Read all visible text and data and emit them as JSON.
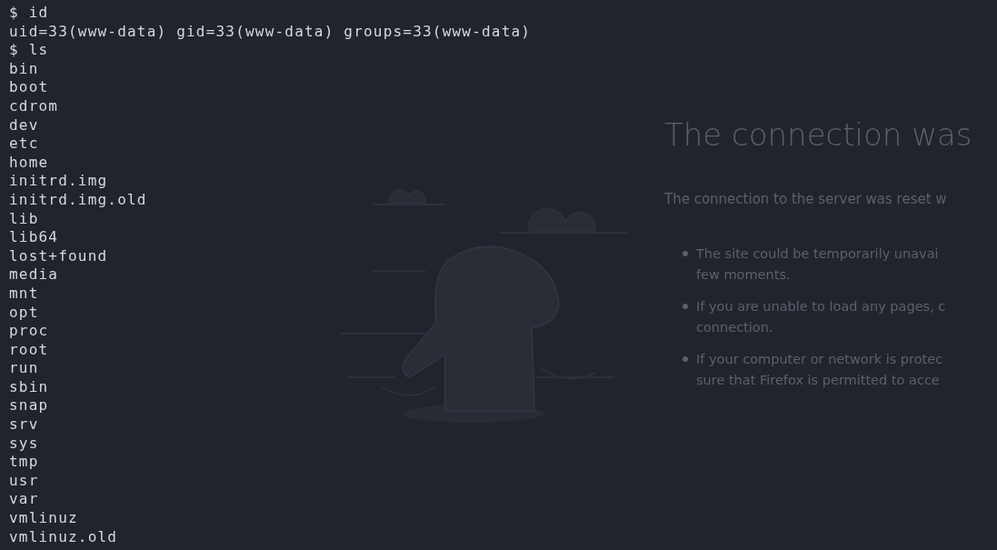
{
  "terminal": {
    "lines": [
      {
        "kind": "command",
        "prompt": "$",
        "text": "id"
      },
      {
        "kind": "output",
        "text": "uid=33(www-data) gid=33(www-data) groups=33(www-data)"
      },
      {
        "kind": "command",
        "prompt": "$",
        "text": "ls"
      },
      {
        "kind": "output",
        "text": "bin"
      },
      {
        "kind": "output",
        "text": "boot"
      },
      {
        "kind": "output",
        "text": "cdrom"
      },
      {
        "kind": "output",
        "text": "dev"
      },
      {
        "kind": "output",
        "text": "etc"
      },
      {
        "kind": "output",
        "text": "home"
      },
      {
        "kind": "output",
        "text": "initrd.img"
      },
      {
        "kind": "output",
        "text": "initrd.img.old"
      },
      {
        "kind": "output",
        "text": "lib"
      },
      {
        "kind": "output",
        "text": "lib64"
      },
      {
        "kind": "output",
        "text": "lost+found"
      },
      {
        "kind": "output",
        "text": "media"
      },
      {
        "kind": "output",
        "text": "mnt"
      },
      {
        "kind": "output",
        "text": "opt"
      },
      {
        "kind": "output",
        "text": "proc"
      },
      {
        "kind": "output",
        "text": "root"
      },
      {
        "kind": "output",
        "text": "run"
      },
      {
        "kind": "output",
        "text": "sbin"
      },
      {
        "kind": "output",
        "text": "snap"
      },
      {
        "kind": "output",
        "text": "srv"
      },
      {
        "kind": "output",
        "text": "sys"
      },
      {
        "kind": "output",
        "text": "tmp"
      },
      {
        "kind": "output",
        "text": "usr"
      },
      {
        "kind": "output",
        "text": "var"
      },
      {
        "kind": "output",
        "text": "vmlinuz"
      },
      {
        "kind": "output",
        "text": "vmlinuz.old"
      }
    ]
  },
  "background_page": {
    "title": "The connection was",
    "message": "The connection to the server was reset w",
    "bullets": [
      {
        "lines": [
          "The site could be temporarily unavai",
          "few moments."
        ]
      },
      {
        "lines": [
          "If you are unable to load any pages, c",
          "connection."
        ]
      },
      {
        "lines": [
          "If your computer or network is protec",
          "sure that Firefox is permitted to acce"
        ]
      }
    ]
  }
}
